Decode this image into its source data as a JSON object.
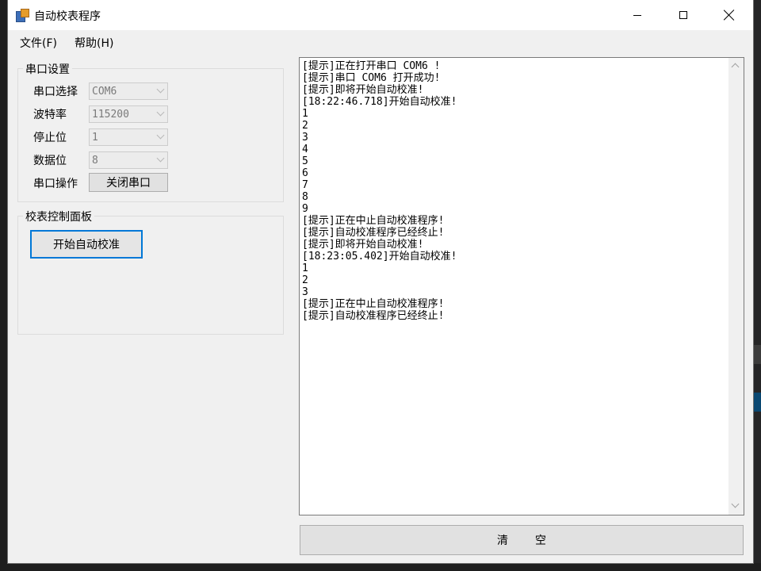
{
  "window": {
    "title": "自动校表程序"
  },
  "menu": {
    "file": "文件(F)",
    "help": "帮助(H)"
  },
  "serial_settings": {
    "group_title": "串口设置",
    "port_label": "串口选择",
    "port_value": "COM6",
    "baud_label": "波特率",
    "baud_value": "115200",
    "stopbits_label": "停止位",
    "stopbits_value": "1",
    "databits_label": "数据位",
    "databits_value": "8",
    "operation_label": "串口操作",
    "close_port_button": "关闭串口"
  },
  "control_panel": {
    "group_title": "校表控制面板",
    "start_button": "开始自动校准"
  },
  "log": {
    "lines": [
      "[提示]正在打开串口 COM6 !",
      "[提示]串口 COM6 打开成功!",
      "[提示]即将开始自动校准!",
      "[18:22:46.718]开始自动校准!",
      "1",
      "2",
      "3",
      "4",
      "5",
      "6",
      "7",
      "8",
      "9",
      "[提示]正在中止自动校准程序!",
      "[提示]自动校准程序已经终止!",
      "[提示]即将开始自动校准!",
      "[18:23:05.402]开始自动校准!",
      "1",
      "2",
      "3",
      "[提示]正在中止自动校准程序!",
      "[提示]自动校准程序已经终止!"
    ]
  },
  "clear_button": "清空"
}
